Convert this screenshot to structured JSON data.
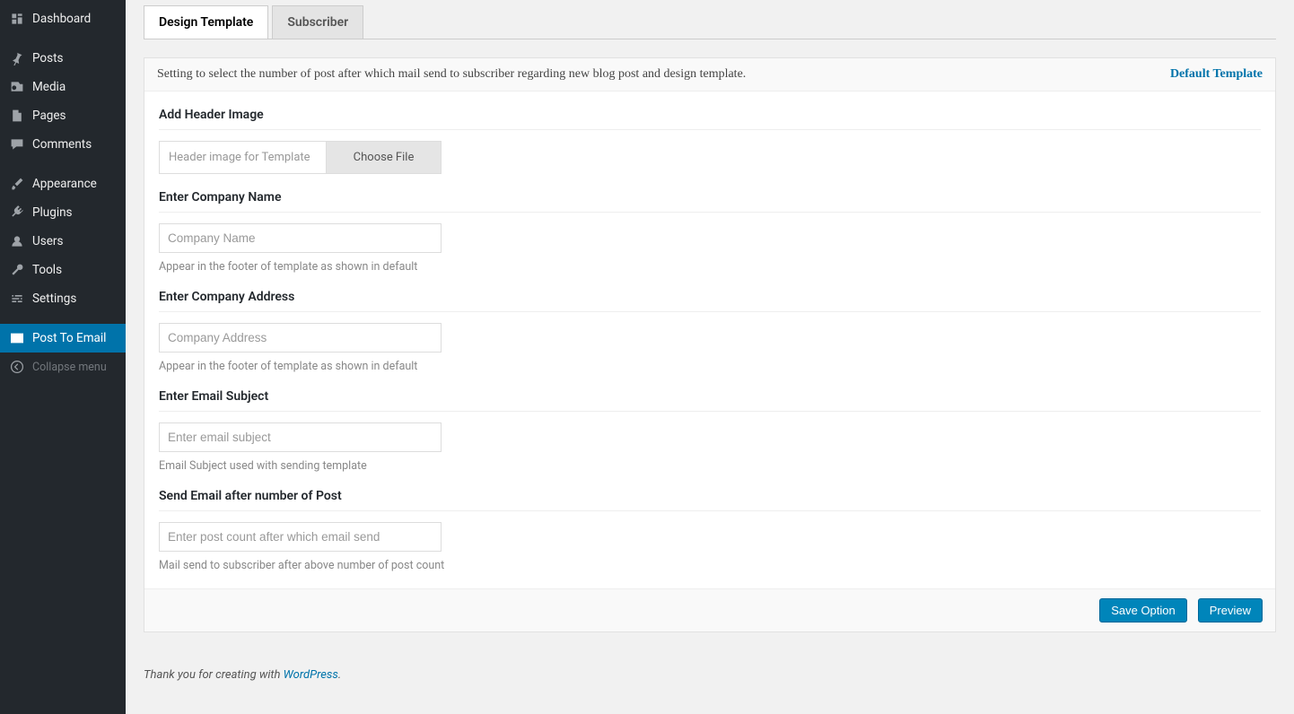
{
  "sidebar": {
    "items": [
      {
        "label": "Dashboard",
        "icon": "dashboard",
        "active": false
      },
      {
        "label": "Posts",
        "icon": "pin",
        "active": false
      },
      {
        "label": "Media",
        "icon": "media",
        "active": false
      },
      {
        "label": "Pages",
        "icon": "page",
        "active": false
      },
      {
        "label": "Comments",
        "icon": "comment",
        "active": false
      },
      {
        "label": "Appearance",
        "icon": "brush",
        "active": false
      },
      {
        "label": "Plugins",
        "icon": "plug",
        "active": false
      },
      {
        "label": "Users",
        "icon": "user",
        "active": false
      },
      {
        "label": "Tools",
        "icon": "wrench",
        "active": false
      },
      {
        "label": "Settings",
        "icon": "settings",
        "active": false
      },
      {
        "label": "Post To Email",
        "icon": "envelope",
        "active": true
      },
      {
        "label": "Collapse menu",
        "icon": "collapse",
        "active": false,
        "collapse": true
      }
    ]
  },
  "tabs": [
    {
      "label": "Design Template",
      "active": true
    },
    {
      "label": "Subscriber",
      "active": false
    }
  ],
  "notice": {
    "text": "Setting to select the number of post after which mail send to subscriber regarding new blog post and design template.",
    "link": "Default Template"
  },
  "fields": {
    "header_image": {
      "title": "Add Header Image",
      "placeholder": "Header image for Template",
      "button": "Choose File"
    },
    "company_name": {
      "title": "Enter Company Name",
      "placeholder": "Company Name",
      "hint": "Appear in the footer of template as shown in default"
    },
    "company_address": {
      "title": "Enter Company Address",
      "placeholder": "Company Address",
      "hint": "Appear in the footer of template as shown in default"
    },
    "email_subject": {
      "title": "Enter Email Subject",
      "placeholder": "Enter email subject",
      "hint": "Email Subject used with sending template"
    },
    "post_count": {
      "title": "Send Email after number of Post",
      "placeholder": "Enter post count after which email send",
      "hint": "Mail send to subscriber after above number of post count"
    }
  },
  "buttons": {
    "save": "Save Option",
    "preview": "Preview"
  },
  "footer": {
    "prefix": "Thank you for creating with ",
    "link": "WordPress",
    "suffix": "."
  }
}
